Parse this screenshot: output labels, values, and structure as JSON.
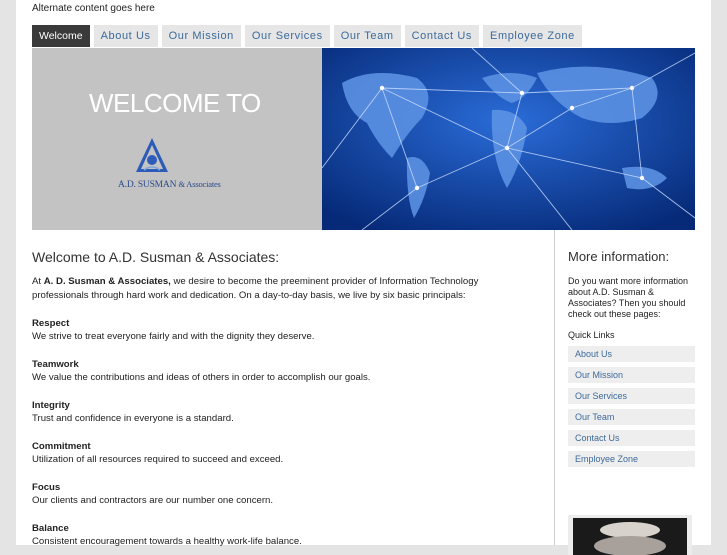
{
  "header": {
    "alt_text": "Alternate content goes here"
  },
  "nav": {
    "items": [
      "Welcome",
      "About Us",
      "Our Mission",
      "Our Services",
      "Our Team",
      "Contact Us",
      "Employee Zone"
    ],
    "active": "Welcome"
  },
  "hero": {
    "welcome_text": "WELCOME TO",
    "logo_name": "A.D. SUSMAN",
    "logo_sub": "& Associates",
    "logo_icon": "triangle-logo-icon",
    "image_subject": "world-map-network-image"
  },
  "main": {
    "title": "Welcome to A.D. Susman & Associates:",
    "intro_prefix": "At",
    "intro_company": "A. D. Susman & Associates,",
    "intro_rest": "we desire to become the preeminent provider of Information Technology professionals through hard work and dedication. On a day-to-day basis, we live by six basic principals:",
    "principles": [
      {
        "heading": "Respect",
        "text": "We strive to treat everyone fairly and with the dignity they deserve."
      },
      {
        "heading": "Teamwork",
        "text": "We value the contributions and ideas of others in order to accomplish our goals."
      },
      {
        "heading": "Integrity",
        "text": "Trust and confidence in everyone is a standard."
      },
      {
        "heading": "Commitment",
        "text": "Utilization of all resources required to succeed and exceed."
      },
      {
        "heading": "Focus",
        "text": "Our clients and contractors are our number one concern."
      },
      {
        "heading": "Balance",
        "text": "Consistent encouragement towards a healthy work-life balance."
      }
    ]
  },
  "sidebar": {
    "title": "More information:",
    "intro": "Do you want more information about A.D. Susman & Associates? Then you should check out these pages:",
    "quick_links_label": "Quick Links",
    "links": [
      "About Us",
      "Our Mission",
      "Our Services",
      "Our Team",
      "Contact Us",
      "Employee Zone"
    ]
  },
  "colors": {
    "nav_text": "#3c6a9a",
    "nav_active_bg": "#3a3a3a",
    "hero_grey": "#c3c3c3",
    "logo_blue": "#2b4a8a",
    "map_blue": "#0a3d9e"
  }
}
